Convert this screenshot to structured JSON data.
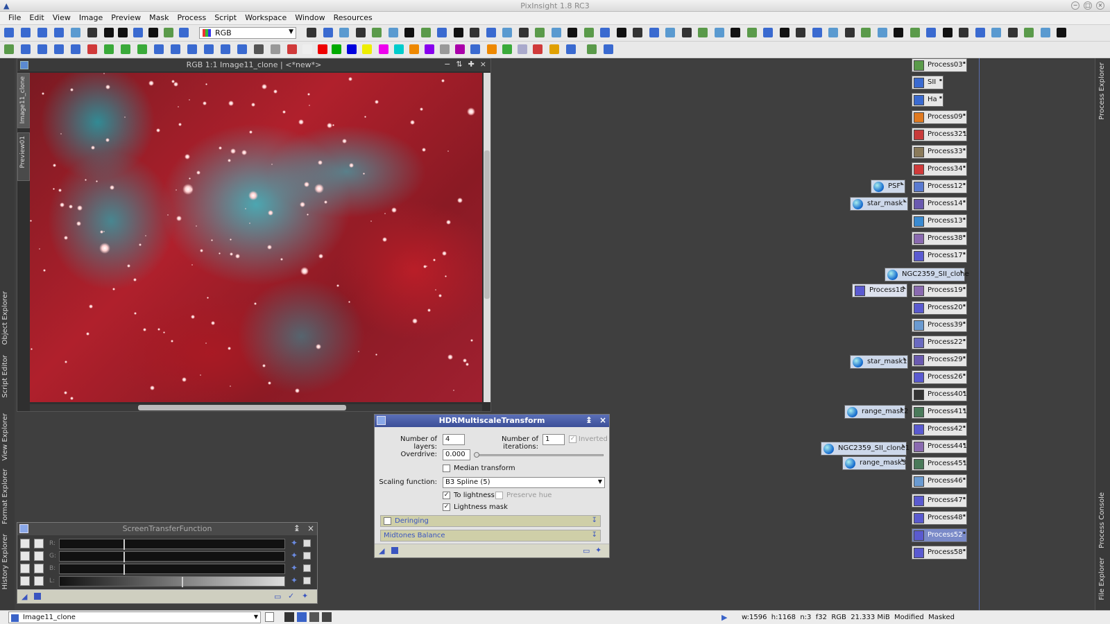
{
  "window": {
    "title": "PixInsight 1.8 RC3"
  },
  "menu": [
    "File",
    "Edit",
    "View",
    "Image",
    "Preview",
    "Mask",
    "Process",
    "Script",
    "Workspace",
    "Window",
    "Resources"
  ],
  "toolbar": {
    "channel_select": "RGB"
  },
  "left_dock": [
    "Object Explorer",
    "Script Editor",
    "View Explorer",
    "Format Explorer",
    "History Explorer"
  ],
  "right_dock": [
    "Process Explorer",
    "Process Console",
    "File Explorer"
  ],
  "image_window": {
    "title": "RGB 1:1 Image11_clone | <*new*>",
    "side_tabs": [
      "Image11_clone",
      "Preview01"
    ]
  },
  "hdr": {
    "title": "HDRMultiscaleTransform",
    "layers_label": "Number of layers:",
    "layers_value": "4",
    "iterations_label": "Number of iterations:",
    "iterations_value": "1",
    "inverted_label": "Inverted",
    "overdrive_label": "Overdrive:",
    "overdrive_value": "0.000",
    "median_label": "Median transform",
    "scaling_label": "Scaling function:",
    "scaling_value": "B3 Spline (5)",
    "lightness_label": "To lightness",
    "preserve_label": "Preserve hue",
    "mask_label": "Lightness mask",
    "deringing_label": "Deringing",
    "midtones_label": "Midtones Balance"
  },
  "stf": {
    "title": "ScreenTransferFunction",
    "channels": [
      "R:",
      "G:",
      "B:",
      "L:"
    ]
  },
  "process_icons": [
    {
      "label": "Process03",
      "color": "#5a9a4a"
    },
    {
      "label": "SII",
      "color": "#3a6ad0"
    },
    {
      "label": "Ha",
      "color": "#3a6ad0"
    },
    {
      "label": "Process09",
      "color": "#e07a20"
    },
    {
      "label": "Process321",
      "color": "#c83a3a"
    },
    {
      "label": "Process33",
      "color": "#8a7a5a"
    },
    {
      "label": "Process34",
      "color": "#d03a3a"
    },
    {
      "label": "Process12",
      "color": "#5a7ad0"
    },
    {
      "label": "Process14",
      "color": "#6a5ab0"
    },
    {
      "label": "Process13",
      "color": "#3a8ad0"
    },
    {
      "label": "Process38",
      "color": "#8a6ab0"
    },
    {
      "label": "Process17",
      "color": "#5a5ad0"
    },
    {
      "label": "Process19",
      "color": "#8a6ab0"
    },
    {
      "label": "Process20",
      "color": "#5a5ad0"
    },
    {
      "label": "Process39",
      "color": "#6a9ad0"
    },
    {
      "label": "Process22",
      "color": "#6a6ac0"
    },
    {
      "label": "Process29",
      "color": "#6a5ab0"
    },
    {
      "label": "Process26",
      "color": "#5a5ad0"
    },
    {
      "label": "Process401",
      "color": "#333333"
    },
    {
      "label": "Process411",
      "color": "#4a7a5a"
    },
    {
      "label": "Process42",
      "color": "#5a5ad0"
    },
    {
      "label": "Process441",
      "color": "#8a6ab0"
    },
    {
      "label": "Process451",
      "color": "#4a7a5a"
    },
    {
      "label": "Process46",
      "color": "#6a9ad0"
    },
    {
      "label": "Process47",
      "color": "#5a5ad0"
    },
    {
      "label": "Process48",
      "color": "#5a5ad0"
    },
    {
      "label": "Process52",
      "color": "#5a5ad0"
    },
    {
      "label": "Process58",
      "color": "#5a5ad0"
    }
  ],
  "image_icons": [
    "PSF",
    "star_mask",
    "NGC2359_SII_clone",
    "Process18",
    "star_mask1",
    "range_mask2",
    "NGC2359_SII_clone1",
    "range_mask3"
  ],
  "status": {
    "view": "Image11_clone",
    "info": "w:1596  h:1168  n:3  f32  RGB  21.333 MiB  Modified  Masked"
  }
}
